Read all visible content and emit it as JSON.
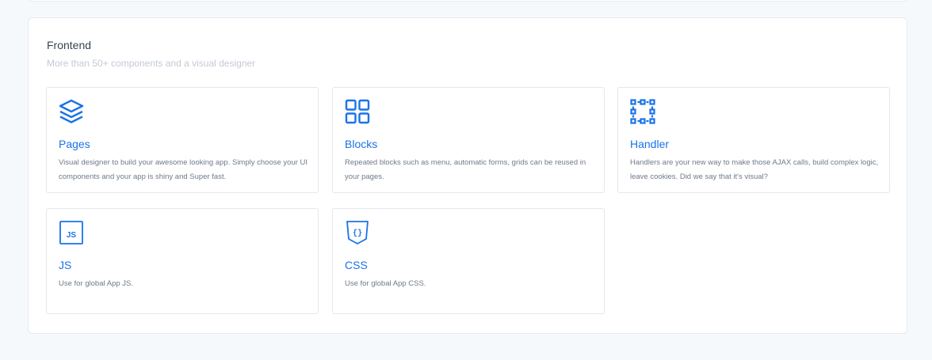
{
  "section": {
    "title": "Frontend",
    "subtitle": "More than 50+ components and a visual designer"
  },
  "cards": [
    {
      "icon": "layers-icon",
      "title": "Pages",
      "description": "Visual designer to build your awesome looking app. Simply choose your UI components and your app is shiny and Super fast."
    },
    {
      "icon": "grid-icon",
      "title": "Blocks",
      "description": "Repeated blocks such as menu, automatic forms, grids can be reused in your pages."
    },
    {
      "icon": "selection-handles-icon",
      "title": "Handler",
      "description": "Handlers are your new way to make those AJAX calls, build complex logic, leave cookies. Did we say that it's visual?"
    },
    {
      "icon": "js-file-icon",
      "icon_text": "JS",
      "title": "JS",
      "description": "Use for global App JS."
    },
    {
      "icon": "css-shield-icon",
      "icon_text": "{}",
      "title": "CSS",
      "description": "Use for global App CSS."
    }
  ],
  "colors": {
    "accent": "#1a73e8",
    "border": "#e3e8ee",
    "background": "#f6f9fc"
  }
}
